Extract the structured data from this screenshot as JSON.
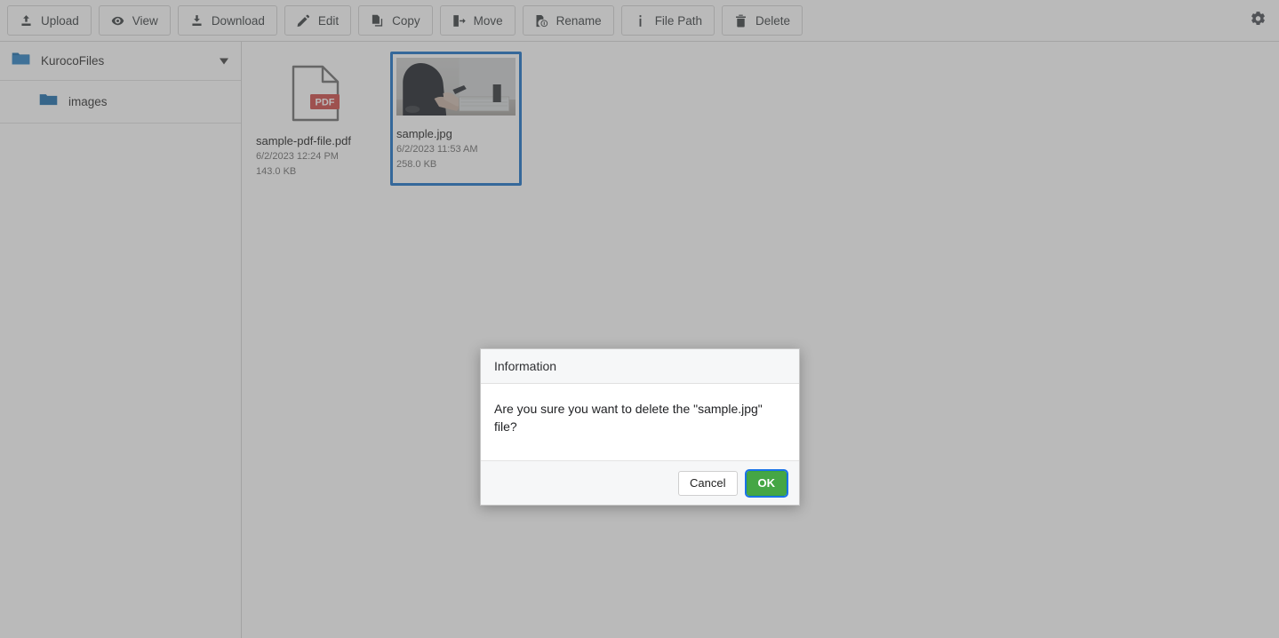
{
  "toolbar": {
    "buttons": [
      {
        "label": "Upload",
        "icon": "upload-icon"
      },
      {
        "label": "View",
        "icon": "eye-icon"
      },
      {
        "label": "Download",
        "icon": "download-icon"
      },
      {
        "label": "Edit",
        "icon": "pencil-icon"
      },
      {
        "label": "Copy",
        "icon": "copy-icon"
      },
      {
        "label": "Move",
        "icon": "move-arrow-icon"
      },
      {
        "label": "Rename",
        "icon": "rename-icon"
      },
      {
        "label": "File Path",
        "icon": "info-icon"
      },
      {
        "label": "Delete",
        "icon": "trash-icon"
      }
    ],
    "settings_icon": "gear-icon"
  },
  "sidebar": {
    "root": {
      "label": "KurocoFiles",
      "icon": "folder-open-icon",
      "expanded": true
    },
    "items": [
      {
        "label": "images",
        "icon": "folder-icon"
      }
    ]
  },
  "files": [
    {
      "name": "sample-pdf-file.pdf",
      "date": "6/2/2023 12:24 PM",
      "size": "143.0 KB",
      "kind": "pdf",
      "badge": "PDF",
      "selected": false
    },
    {
      "name": "sample.jpg",
      "date": "6/2/2023 11:53 AM",
      "size": "258.0 KB",
      "kind": "image",
      "badge": "",
      "selected": true
    }
  ],
  "dialog": {
    "title": "Information",
    "message": "Are you sure you want to delete the \"sample.jpg\" file?",
    "cancel_label": "Cancel",
    "ok_label": "OK"
  },
  "colors": {
    "accent_blue": "#1a73c8",
    "folder_blue": "#1e6fad",
    "ok_green": "#45a645",
    "focus_blue": "#1a73e8",
    "pdf_red": "#cf4a47",
    "toolbar_text": "#3c4043"
  }
}
